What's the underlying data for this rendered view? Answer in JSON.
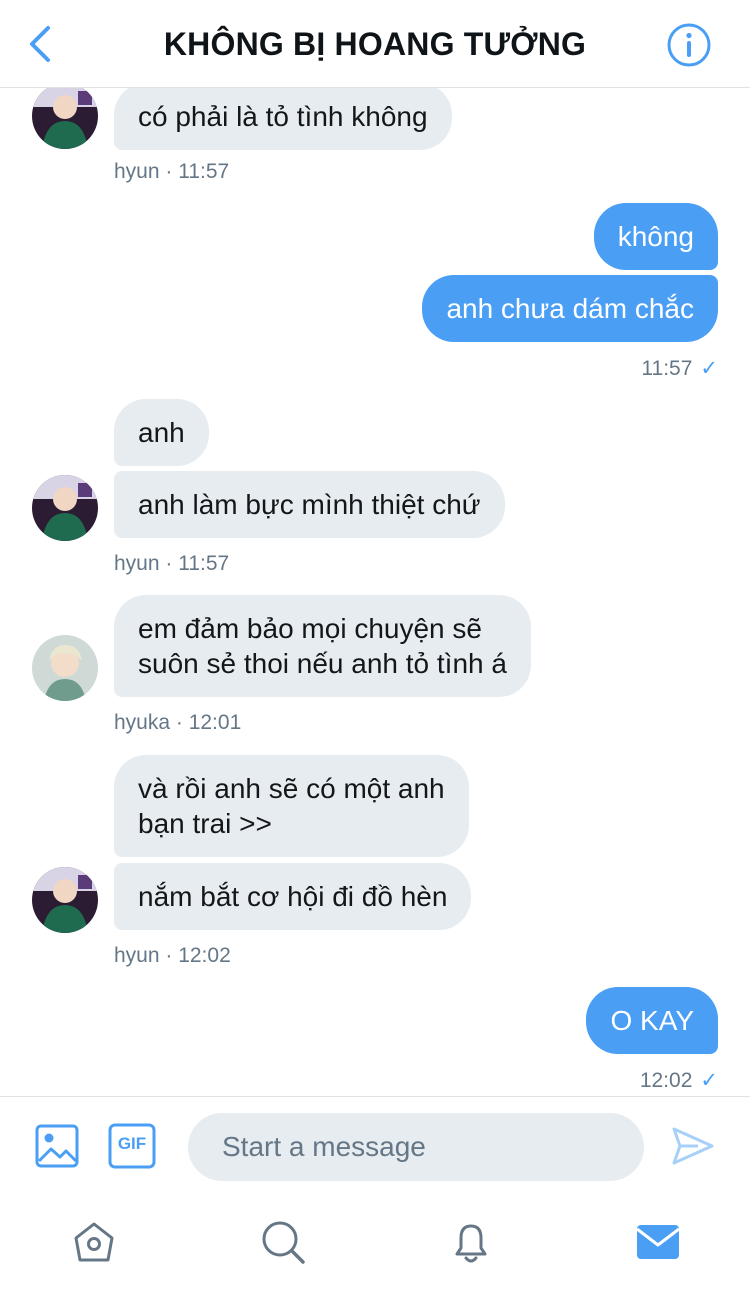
{
  "header": {
    "title": "KHÔNG BỊ HOANG TƯỞNG",
    "back_icon": "chevron-left-icon",
    "info_icon": "info-icon"
  },
  "messages": [
    {
      "side": "in",
      "text": "có phải là tỏ tình không"
    },
    {
      "meta": "hyun · 11:57"
    },
    {
      "side": "out",
      "text": "không"
    },
    {
      "side": "out",
      "text": "anh chưa dám chắc"
    },
    {
      "meta": "11:57"
    },
    {
      "side": "in",
      "text": "anh"
    },
    {
      "side": "in",
      "text": "anh làm bực mình thiệt chứ"
    },
    {
      "meta": "hyun · 11:57"
    },
    {
      "side": "in",
      "line1": "em đảm bảo mọi chuyện sẽ",
      "line2": "suôn sẻ thoi nếu anh tỏ tình á"
    },
    {
      "meta": "hyuka · 12:01"
    },
    {
      "side": "in",
      "line1": "và rồi anh sẽ có một anh",
      "line2": "bạn trai >>"
    },
    {
      "side": "in",
      "text": "nắm bắt cơ hội đi đồ hèn"
    },
    {
      "meta": "hyun · 12:02"
    },
    {
      "side": "out",
      "text": "O KAY"
    },
    {
      "meta": "12:02"
    }
  ],
  "read_check": "✓",
  "composer": {
    "placeholder": "Start a message",
    "gif_label": "GIF",
    "image_icon": "image-icon",
    "send_icon": "send-icon"
  },
  "tabs": [
    "home-icon",
    "search-icon",
    "bell-icon",
    "mail-icon"
  ],
  "colors": {
    "accent": "#4a9ff5",
    "incoming_bubble": "#e6ecf0",
    "meta_text": "#657786"
  }
}
